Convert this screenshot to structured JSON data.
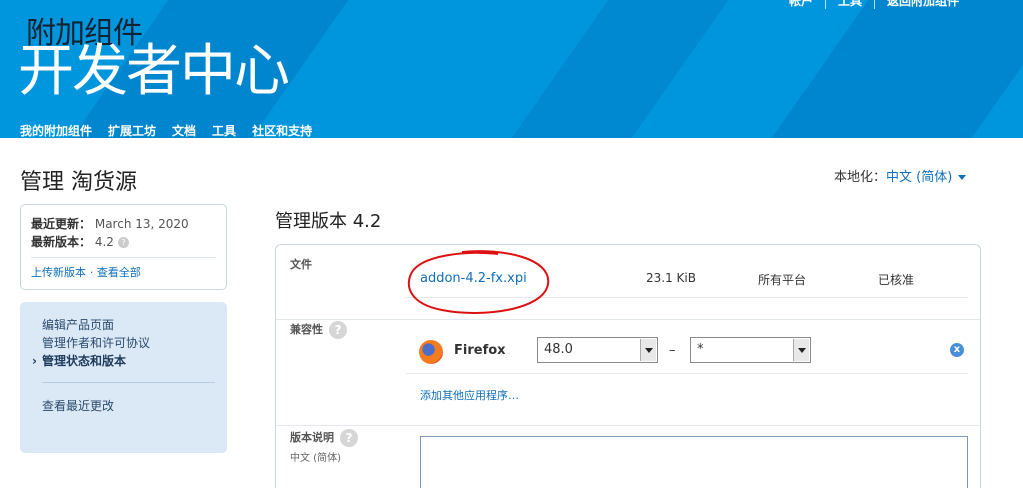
{
  "header": {
    "top_links": [
      "帐户",
      "工具",
      "返回附加组件"
    ],
    "brand_sub": "附加组件",
    "brand_main": "开发者中心",
    "nav": [
      "我的附加组件",
      "扩展工坊",
      "文档",
      "工具",
      "社区和支持"
    ],
    "colors": {
      "bar": "#0096dd"
    }
  },
  "page": {
    "title": "管理 淘货源",
    "locale_label": "本地化：",
    "locale_value": "中文 (简体)"
  },
  "info": {
    "updated_label": "最近更新：",
    "updated_value": "March 13, 2020",
    "version_label": "最新版本：",
    "version_value": "4.2",
    "upload_link": "上传新版本",
    "view_all_link": "· 查看全部"
  },
  "sidenav": {
    "items": [
      "编辑产品页面",
      "管理作者和许可协议",
      "管理状态和版本"
    ],
    "active_index": 2,
    "recent": "查看最近更改"
  },
  "main": {
    "title": "管理版本 4.2",
    "files_label": "文件",
    "file": {
      "name": "addon-4.2-fx.xpi",
      "size": "23.1 KiB",
      "platform": "所有平台",
      "status": "已核准"
    },
    "compat_label": "兼容性",
    "compat": {
      "app": "Firefox",
      "min": "48.0",
      "max": "*",
      "dash": "–"
    },
    "add_app_link": "添加其他应用程序…",
    "notes_label": "版本说明",
    "notes_locale": "中文 (简体)",
    "notes_value": ""
  }
}
